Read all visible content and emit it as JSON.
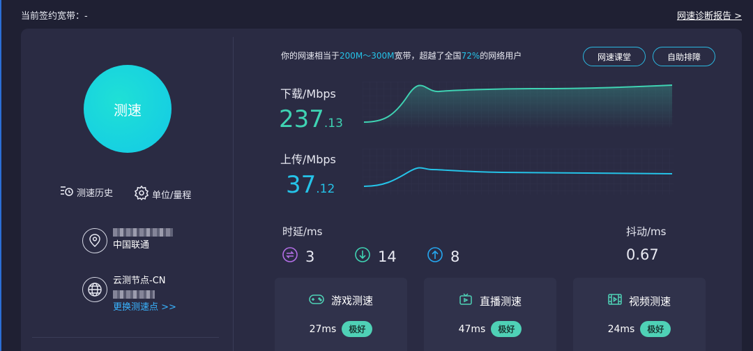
{
  "header": {
    "broadband_label": "当前签约宽带：-",
    "diagnosis_link": "网速诊断报告 >"
  },
  "left": {
    "speedtest_button": "测速",
    "history_label": "测速历史",
    "unit_label": "单位/量程",
    "isp_name": "中国联通",
    "node_name": "云测节点-CN",
    "change_node": "更换测速点 >>"
  },
  "summary": {
    "prefix": "你的网速相当于",
    "range": "200M～300M",
    "middle": "宽带，超越了全国",
    "percent": "72%",
    "suffix": "的网络用户"
  },
  "buttons": {
    "speed_class": "网速课堂",
    "self_check": "自助排障"
  },
  "download": {
    "label": "下载/Mbps",
    "value_int": "237",
    "value_frac": ".13"
  },
  "upload": {
    "label": "上传/Mbps",
    "value_int": "37",
    "value_frac": ".12"
  },
  "latency": {
    "label": "时延/ms",
    "ping": "3",
    "down": "14",
    "up": "8"
  },
  "jitter": {
    "label": "抖动/ms",
    "value": "0.67"
  },
  "tests": {
    "game": {
      "title": "游戏测速",
      "ms": "27ms",
      "badge": "极好"
    },
    "live": {
      "title": "直播测速",
      "ms": "47ms",
      "badge": "极好"
    },
    "video": {
      "title": "视频测速",
      "ms": "24ms",
      "badge": "极好"
    }
  },
  "colors": {
    "accent_download": "#3fd3b3",
    "accent_upload": "#25c3e8",
    "badge": "#4fd1b6",
    "link": "#39b4ff"
  }
}
